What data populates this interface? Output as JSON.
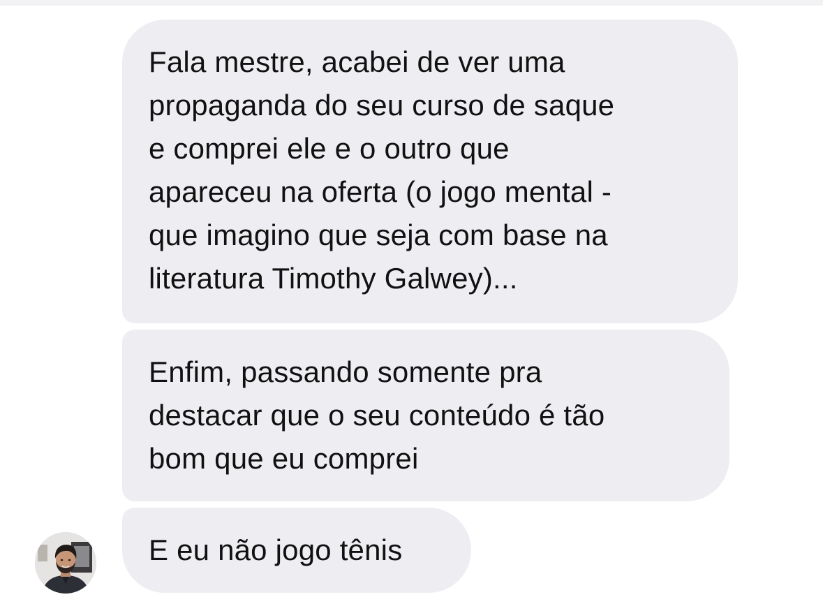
{
  "conversation": {
    "messages": [
      {
        "text": "Fala mestre, acabei de ver uma\npropaganda do seu curso de saque\ne comprei ele e o outro que\napareceu na oferta (o jogo mental -\nque imagino que seja com base na\nliteratura Timothy Galwey)..."
      },
      {
        "text": "Enfim, passando somente pra\ndestacar que o seu conteúdo é tão\nbom que eu comprei"
      },
      {
        "text": "E eu não jogo tênis"
      }
    ],
    "sender_avatar_icon": "profile-photo"
  },
  "colors": {
    "bubble_background": "#eeeef2",
    "text": "#111111",
    "page_background": "#ffffff"
  }
}
